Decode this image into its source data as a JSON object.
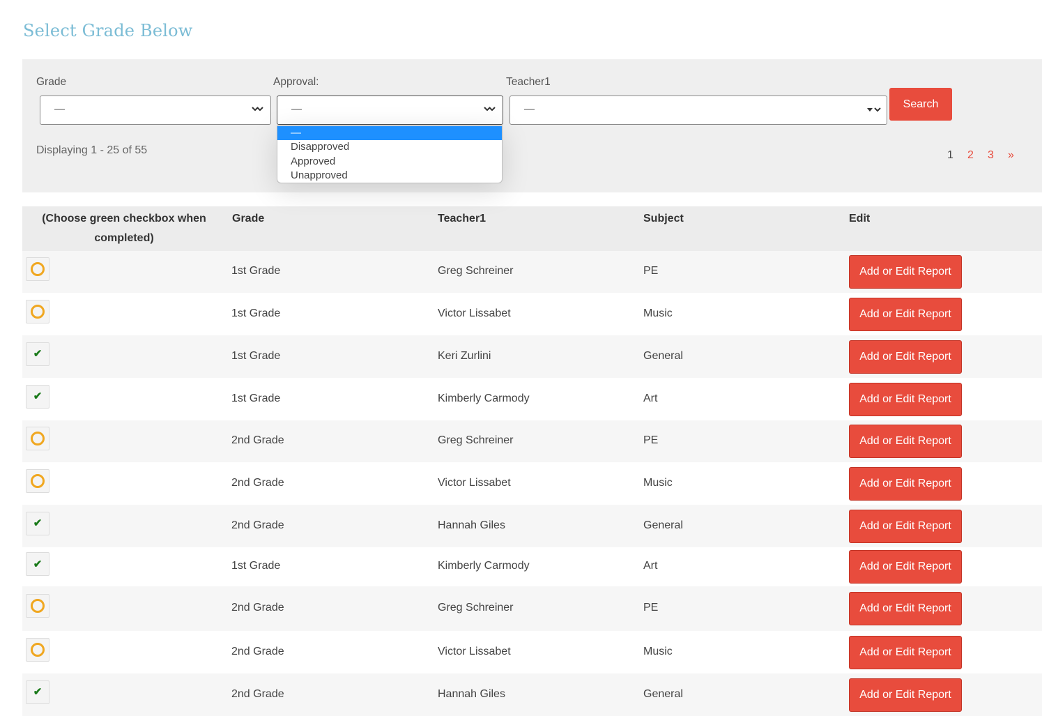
{
  "page": {
    "title": "Select Grade Below"
  },
  "filters": {
    "grade": {
      "label": "Grade",
      "value": "—"
    },
    "approval": {
      "label": "Approval:",
      "value": "—",
      "options": [
        "—",
        "Disapproved",
        "Approved",
        "Unapproved"
      ]
    },
    "teacher": {
      "label": "Teacher1",
      "value": "—"
    },
    "search_label": "Search"
  },
  "results": {
    "displaying": "Displaying 1 - 25 of 55",
    "pagination": [
      "1",
      "2",
      "3",
      "»"
    ]
  },
  "table": {
    "headers": [
      "(Choose green checkbox when completed)",
      "Grade",
      "Teacher1",
      "Subject",
      "Edit"
    ],
    "edit_label": "Add or Edit Report",
    "rows": [
      {
        "status": "pending",
        "grade": "1st Grade",
        "teacher": "Greg Schreiner",
        "subject": "PE"
      },
      {
        "status": "pending",
        "grade": "1st Grade",
        "teacher": "Victor Lissabet",
        "subject": "Music"
      },
      {
        "status": "completed",
        "grade": "1st Grade",
        "teacher": "Keri Zurlini",
        "subject": "General"
      },
      {
        "status": "completed",
        "grade": "1st Grade",
        "teacher": "Kimberly Carmody",
        "subject": "Art"
      },
      {
        "status": "pending",
        "grade": "2nd Grade",
        "teacher": "Greg Schreiner",
        "subject": "PE"
      },
      {
        "status": "pending",
        "grade": "2nd Grade",
        "teacher": "Victor Lissabet",
        "subject": "Music"
      },
      {
        "status": "completed",
        "grade": "2nd Grade",
        "teacher": "Hannah Giles",
        "subject": "General"
      },
      {
        "status": "completed",
        "grade": "1st Grade",
        "teacher": "Kimberly Carmody",
        "subject": "Art"
      },
      {
        "status": "pending",
        "grade": "2nd Grade",
        "teacher": "Greg Schreiner",
        "subject": "PE"
      },
      {
        "status": "pending",
        "grade": "2nd Grade",
        "teacher": "Victor Lissabet",
        "subject": "Music"
      },
      {
        "status": "completed",
        "grade": "2nd Grade",
        "teacher": "Hannah Giles",
        "subject": "General"
      }
    ]
  },
  "colors": {
    "accent": "#e84c3d",
    "title": "#7bbcd5",
    "pending": "#f0a720",
    "completed": "#1a7a1a",
    "dropdown_highlight": "#1e90ff"
  },
  "icons": {
    "pending": "pending-circle-icon",
    "completed": "checkmark-icon",
    "select_arrow": "chevron-down-icon"
  }
}
